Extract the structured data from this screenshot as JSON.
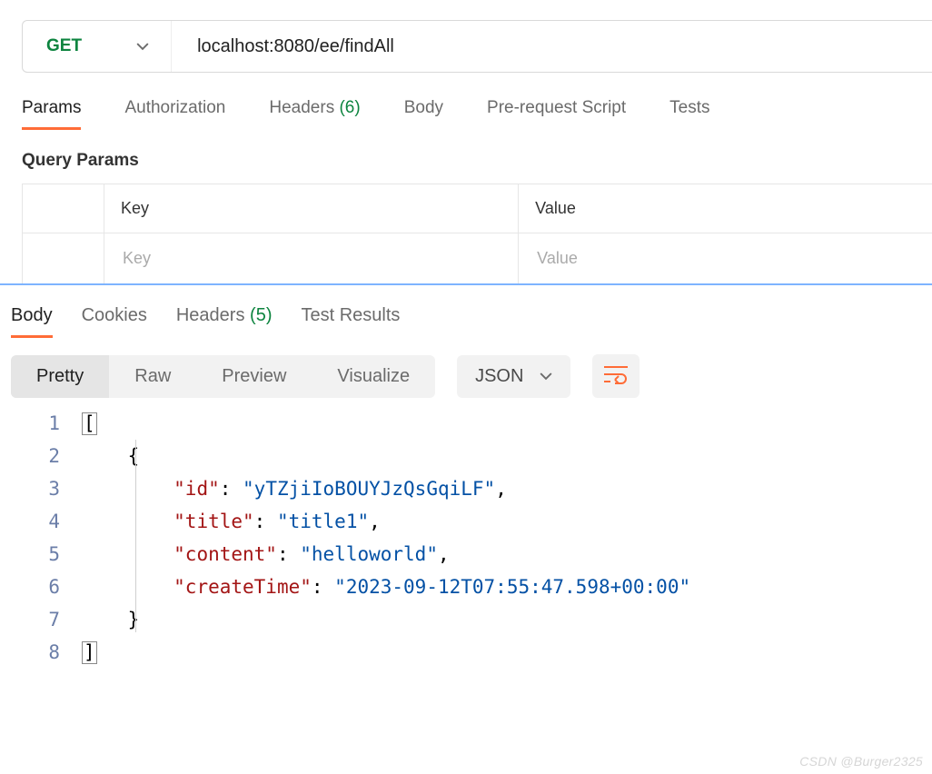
{
  "request": {
    "method": "GET",
    "url": "localhost:8080/ee/findAll",
    "tabs": [
      {
        "label": "Params",
        "active": true
      },
      {
        "label": "Authorization"
      },
      {
        "label": "Headers",
        "count": "(6)"
      },
      {
        "label": "Body"
      },
      {
        "label": "Pre-request Script"
      },
      {
        "label": "Tests"
      }
    ],
    "query_params": {
      "title": "Query Params",
      "headers": {
        "key": "Key",
        "value": "Value"
      },
      "row_placeholder": {
        "key": "Key",
        "value": "Value"
      }
    }
  },
  "response": {
    "tabs": [
      {
        "label": "Body",
        "active": true
      },
      {
        "label": "Cookies"
      },
      {
        "label": "Headers",
        "count": "(5)"
      },
      {
        "label": "Test Results"
      }
    ],
    "views": [
      {
        "label": "Pretty",
        "active": true
      },
      {
        "label": "Raw"
      },
      {
        "label": "Preview"
      },
      {
        "label": "Visualize"
      }
    ],
    "format": "JSON",
    "line_numbers": [
      "1",
      "2",
      "3",
      "4",
      "5",
      "6",
      "7",
      "8"
    ],
    "json": {
      "id_key": "\"id\"",
      "id_val": "\"yTZjiIoBOUYJzQsGqiLF\"",
      "title_key": "\"title\"",
      "title_val": "\"title1\"",
      "content_key": "\"content\"",
      "content_val": "\"helloworld\"",
      "ct_key": "\"createTime\"",
      "ct_val": "\"2023-09-12T07:55:47.598+00:00\""
    },
    "brackets": {
      "open_arr": "[",
      "close_arr": "]",
      "open_obj": "{",
      "close_obj": "}"
    }
  },
  "watermark": "CSDN @Burger2325"
}
